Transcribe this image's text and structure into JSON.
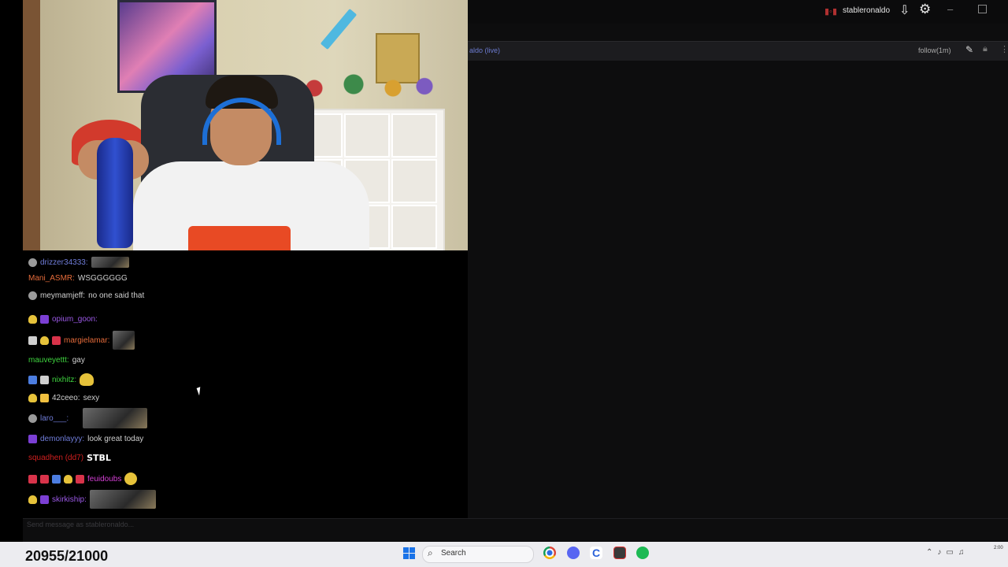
{
  "titlebar": {
    "username": "stableronaldo",
    "icons": [
      "live-indicator-icon",
      "download-icon",
      "gear-icon",
      "minimize-icon",
      "maximize-icon"
    ]
  },
  "tabbar": {
    "channel_label": "aldo (live)",
    "follow_mode": "follow(1m)"
  },
  "chat": {
    "messages": [
      {
        "user": "drizzer34333:",
        "text": ""
      },
      {
        "user": "Mani_ASMR:",
        "text": "WSGGGGGG"
      },
      {
        "user": "meymamjeff:",
        "text": "no one said that"
      },
      {
        "user": "opium_goon:",
        "text": ""
      },
      {
        "user": "margielamar:",
        "text": ""
      },
      {
        "user": "mauveyettt:",
        "text": "gay"
      },
      {
        "user": "nixhitz:",
        "text": ""
      },
      {
        "user": "42ceeo:",
        "text": "sexy"
      },
      {
        "user": "laro___:",
        "text": ""
      },
      {
        "user": "demonlayyy:",
        "text": "look great today"
      },
      {
        "user": "squadhen (dd7)",
        "text": "STBL"
      },
      {
        "user": "feuidoubs",
        "text": ""
      },
      {
        "user": "skirkiship:",
        "text": ""
      }
    ],
    "input_placeholder": "Send message as stableronaldo..."
  },
  "overlay": {
    "counter": "20955/21000"
  },
  "taskbar": {
    "search_label": "Search",
    "apps": [
      "chrome-icon",
      "discord-icon",
      "c-app-icon",
      "recorder-icon",
      "spotify-icon"
    ],
    "clock": "2:00"
  },
  "colors": {
    "chat_bg": "#000000",
    "panel_bg": "#0d0d0e",
    "taskbar_bg": "#ececf0",
    "accent": "#6c7bd1"
  }
}
